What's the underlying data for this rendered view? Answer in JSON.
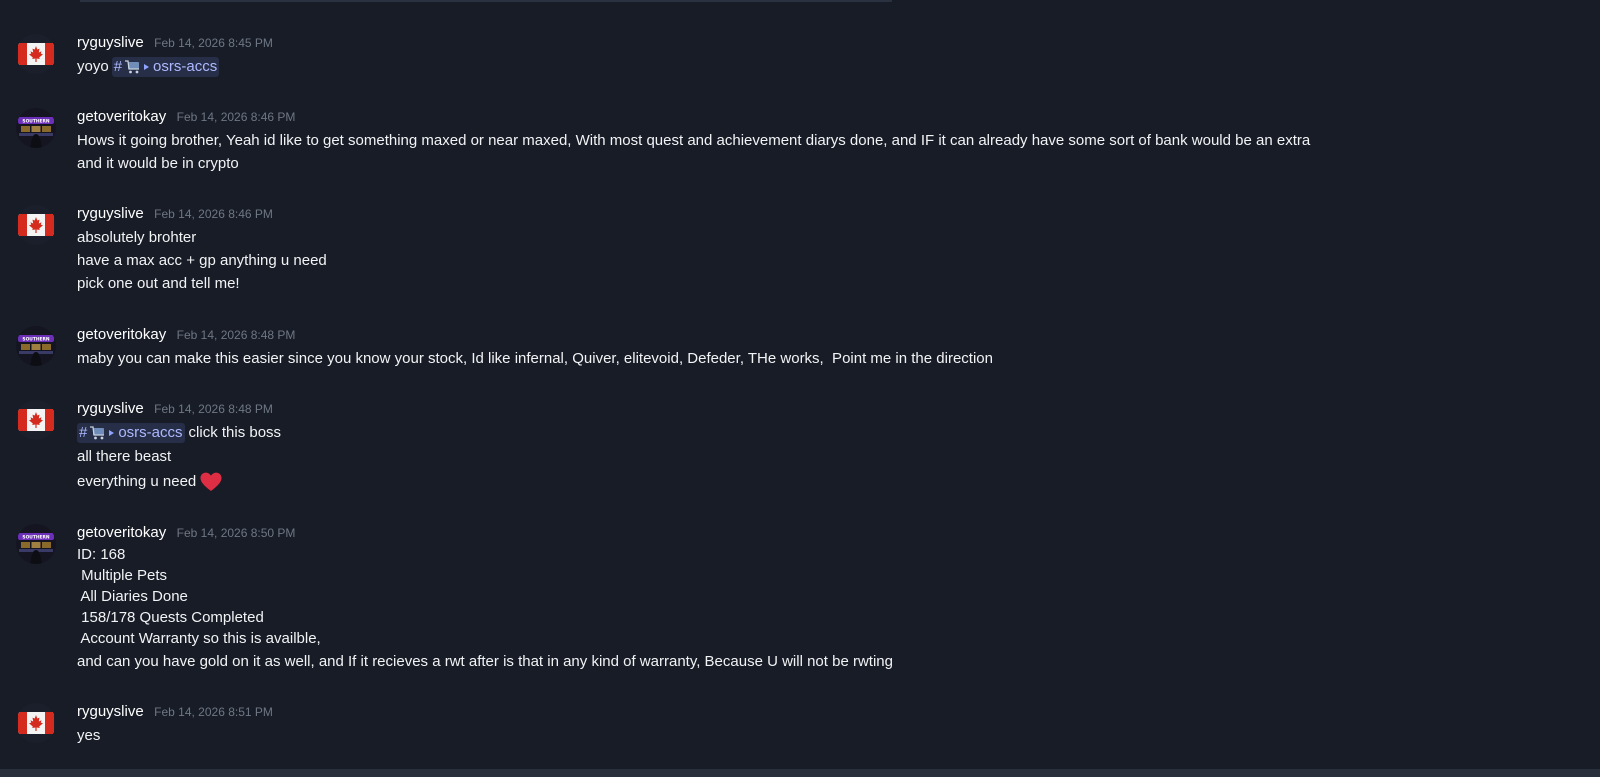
{
  "channel_mention": {
    "hash": "#",
    "icon": "shopping-cart-icon",
    "name": "osrs-accs"
  },
  "messages": [
    {
      "author": "ryguyslive",
      "avatar": "canada-flag-avatar",
      "timestamp": "Feb 14, 2026 8:45 PM",
      "lines": [
        "yoyo"
      ]
    },
    {
      "author": "getoveritokay",
      "avatar": "southern-banner-avatar",
      "timestamp": "Feb 14, 2026 8:46 PM",
      "lines": [
        "Hows it going brother, Yeah id like to get something maxed or near maxed, With most quest and achievement diarys done, and IF it can already have some sort of bank would be an extra",
        "and it would be in crypto"
      ]
    },
    {
      "author": "ryguyslive",
      "avatar": "canada-flag-avatar",
      "timestamp": "Feb 14, 2026 8:46 PM",
      "lines": [
        "absolutely brohter",
        "have a max acc + gp anything u need",
        "pick one out and tell me!"
      ]
    },
    {
      "author": "getoveritokay",
      "avatar": "southern-banner-avatar",
      "timestamp": "Feb 14, 2026 8:48 PM",
      "lines": [
        "maby you can make this easier since you know your stock, Id like infernal, Quiver, elitevoid, Defeder, THe works,  Point me in the direction"
      ]
    },
    {
      "author": "ryguyslive",
      "avatar": "canada-flag-avatar",
      "timestamp": "Feb 14, 2026 8:48 PM",
      "lines": [
        "click this boss",
        "all there beast",
        "everything u need"
      ]
    },
    {
      "author": "getoveritokay",
      "avatar": "southern-banner-avatar",
      "timestamp": "Feb 14, 2026 8:50 PM",
      "lines": [
        "ID: 168",
        " Multiple Pets",
        " All Diaries Done",
        " 158/178 Quests Completed",
        " Account Warranty so this is availble,",
        "and can you have gold on it as well, and If it recieves a rwt after is that in any kind of warranty, Because U will not be rwting"
      ]
    },
    {
      "author": "ryguyslive",
      "avatar": "canada-flag-avatar",
      "timestamp": "Feb 14, 2026 8:51 PM",
      "lines": [
        "yes"
      ]
    }
  ],
  "emoji": {
    "heart": "red-heart-icon"
  },
  "colors": {
    "background": "#171c26",
    "mention_bg": "#262f47",
    "mention_text": "#aeb8ff",
    "timestamp": "#6f7785"
  }
}
